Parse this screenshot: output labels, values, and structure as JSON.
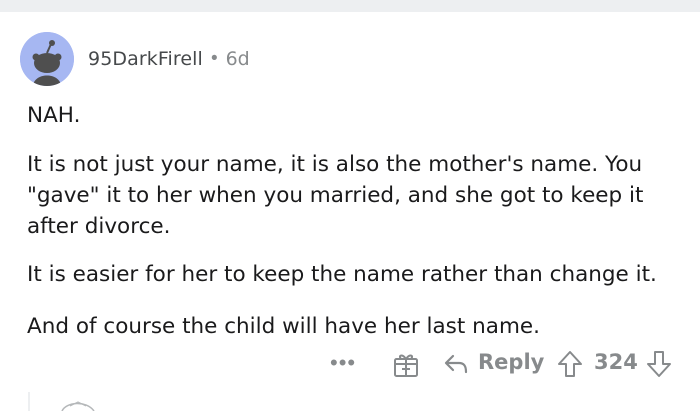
{
  "comment": {
    "username": "95DarkFirell",
    "separator": "•",
    "age": "6d",
    "paragraphs": [
      "NAH.",
      "It is not just your name, it is also the mother's name. You \"gave\" it to her when you married, and she got to keep it after divorce.",
      "It is easier for her to keep the name rather than change it.",
      "And of course the child will have her last name."
    ]
  },
  "actions": {
    "more_label": "•••",
    "reply_label": "Reply",
    "score": "324"
  },
  "icons": {
    "avatar": "snoo-avatar-icon",
    "award": "gift-award-icon",
    "reply": "reply-arrow-icon",
    "upvote": "upvote-arrow-icon",
    "downvote": "downvote-arrow-icon"
  },
  "colors": {
    "avatar_bg": "#a6b7f2",
    "meta_text": "#878a8c",
    "body_text": "#1a1a1b",
    "top_band": "#edeff1"
  }
}
